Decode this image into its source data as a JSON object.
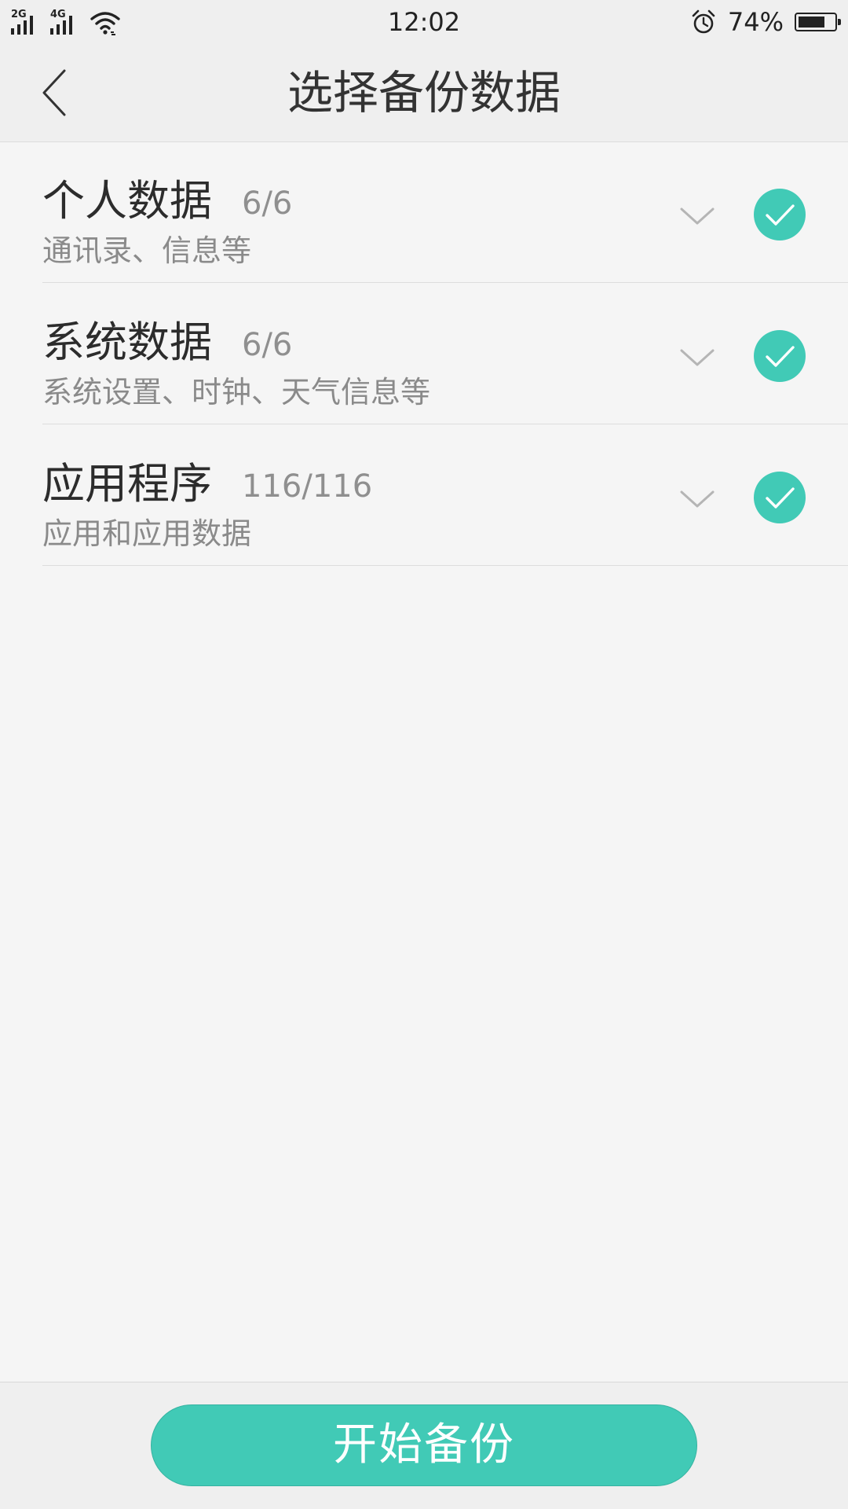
{
  "status_bar": {
    "sim1_network": "2G",
    "sim2_network": "4G",
    "time": "12:02",
    "battery_percent_label": "74%",
    "battery_level": 0.74,
    "icons": [
      "signal-icon",
      "wifi-icon",
      "alarm-icon",
      "battery-icon"
    ]
  },
  "header": {
    "title": "选择备份数据",
    "back_icon": "chevron-left-icon"
  },
  "categories": [
    {
      "title": "个人数据",
      "count": "6/6",
      "subtitle": "通讯录、信息等",
      "checked": true
    },
    {
      "title": "系统数据",
      "count": "6/6",
      "subtitle": "系统设置、时钟、天气信息等",
      "checked": true
    },
    {
      "title": "应用程序",
      "count": "116/116",
      "subtitle": "应用和应用数据",
      "checked": true
    }
  ],
  "footer": {
    "start_button_label": "开始备份"
  },
  "colors": {
    "accent": "#41cab6",
    "background": "#f5f5f5",
    "bar_background": "#efefef"
  }
}
